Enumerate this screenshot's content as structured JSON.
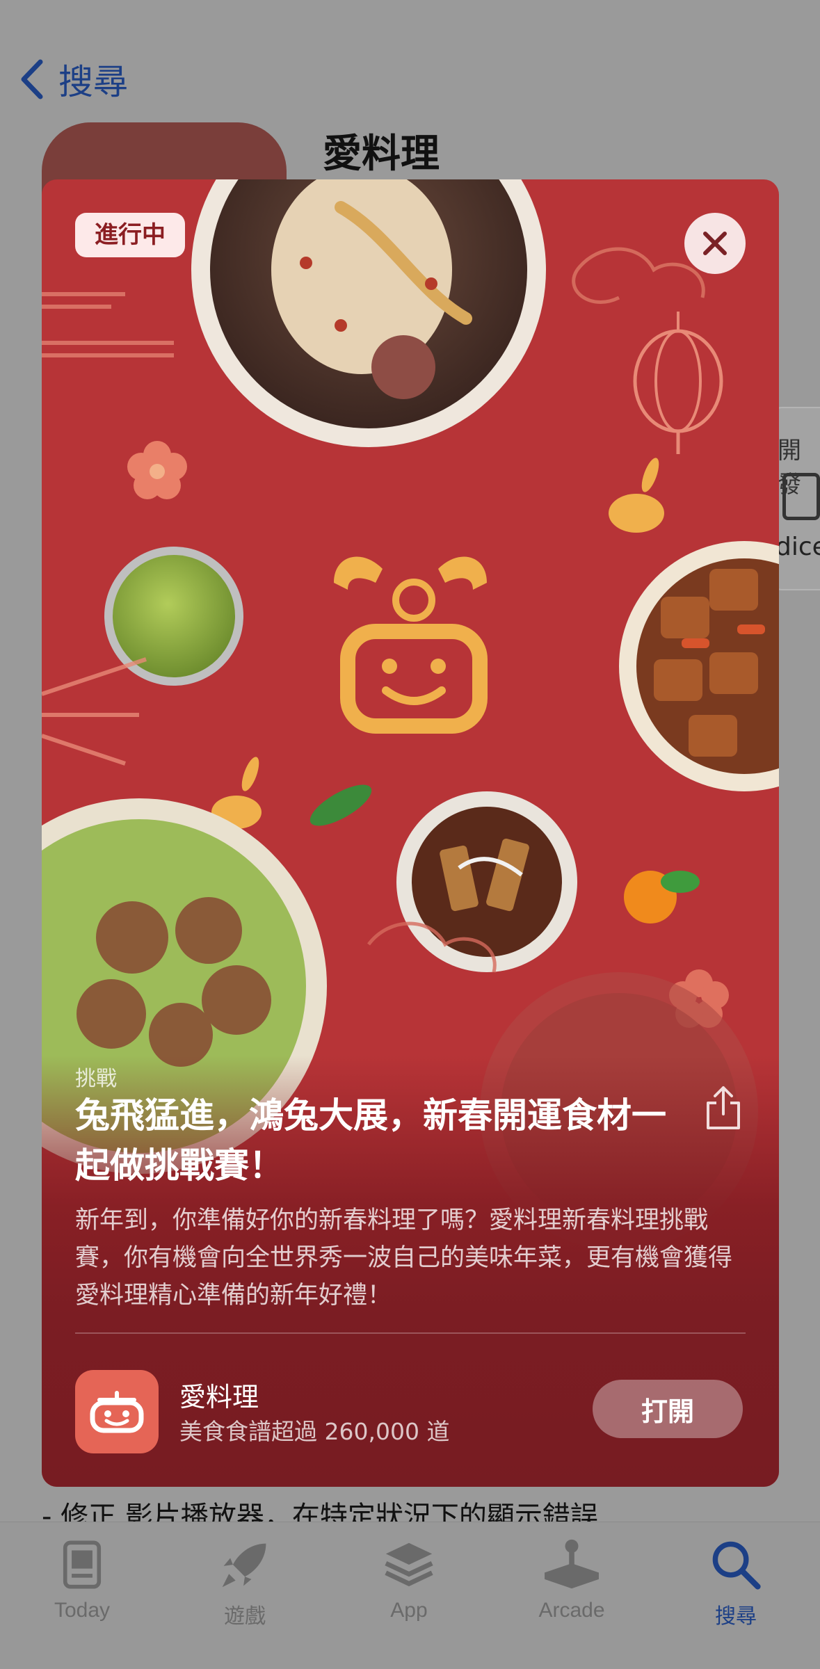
{
  "nav": {
    "back_label": "搜尋"
  },
  "app_page": {
    "title": "愛料理",
    "side_card_label": "開發",
    "side_card_text": "dice",
    "release_note": "- 修正 影片播放器，在特定狀況下的顯示錯誤"
  },
  "card": {
    "badge": "進行中",
    "eyebrow": "挑戰",
    "headline": "兔飛猛進，鴻兔大展，新春開運食材一起做挑戰賽！",
    "description": "新年到，你準備好你的新春料理了嗎？愛料理新春料理挑戰賽，你有機會向全世界秀一波自己的美味年菜，更有機會獲得愛料理精心準備的新年好禮！",
    "app_name": "愛料理",
    "app_subtitle": "美食食譜超過 260,000 道",
    "open_label": "打開"
  },
  "tabs": [
    {
      "label": "Today",
      "icon": "today-icon",
      "active": false
    },
    {
      "label": "遊戲",
      "icon": "rocket-icon",
      "active": false
    },
    {
      "label": "App",
      "icon": "layers-icon",
      "active": false
    },
    {
      "label": "Arcade",
      "icon": "joystick-icon",
      "active": false
    },
    {
      "label": "搜尋",
      "icon": "search-icon",
      "active": true
    }
  ],
  "colors": {
    "card_red": "#b73437",
    "accent_blue": "#1c3f86",
    "gold": "#f0b04c"
  }
}
